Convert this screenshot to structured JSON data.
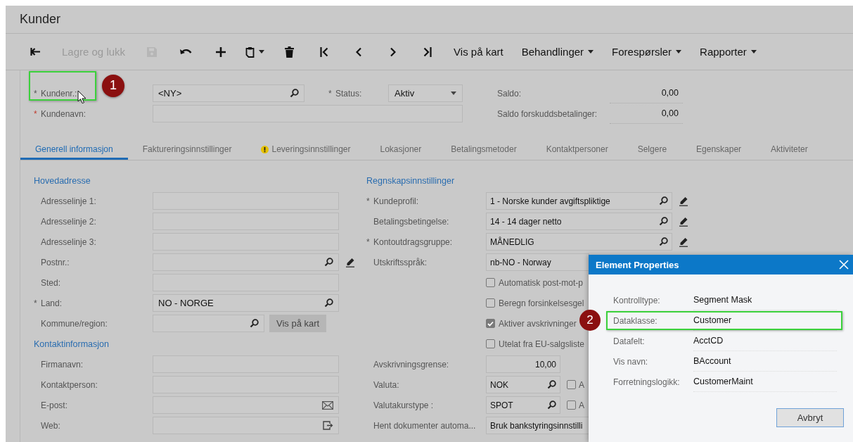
{
  "window": {
    "title": "Kunder"
  },
  "toolbar": [
    {
      "kind": "back",
      "disabled": false,
      "dropdown": false
    },
    {
      "kind": "text",
      "label": "Lagre og lukk",
      "disabled": true,
      "dropdown": false
    },
    {
      "kind": "save",
      "disabled": true,
      "dropdown": false
    },
    {
      "kind": "undo",
      "disabled": false,
      "dropdown": false
    },
    {
      "kind": "add",
      "disabled": false,
      "dropdown": false
    },
    {
      "kind": "paste",
      "disabled": false,
      "dropdown": true
    },
    {
      "kind": "delete",
      "disabled": false,
      "dropdown": false
    },
    {
      "kind": "first",
      "disabled": false,
      "dropdown": false
    },
    {
      "kind": "prev",
      "disabled": false,
      "dropdown": false
    },
    {
      "kind": "next",
      "disabled": false,
      "dropdown": false
    },
    {
      "kind": "last",
      "disabled": false,
      "dropdown": false
    },
    {
      "kind": "text",
      "label": "Vis på kart",
      "disabled": false,
      "dropdown": false
    },
    {
      "kind": "text",
      "label": "Behandlinger",
      "disabled": false,
      "dropdown": true
    },
    {
      "kind": "text",
      "label": "Forespørsler",
      "disabled": false,
      "dropdown": true
    },
    {
      "kind": "text",
      "label": "Rapporter",
      "disabled": false,
      "dropdown": true
    }
  ],
  "header": {
    "customer_id": {
      "mark": "*",
      "error": false,
      "label": "Kundenr.:",
      "value": "<NY>",
      "highlight": true,
      "callout": "1"
    },
    "status": {
      "mark": "*",
      "error": false,
      "label": "Status:",
      "value": "Aktiv"
    },
    "customer_name": {
      "mark": "*",
      "error": true,
      "label": "Kundenavn:"
    },
    "balances": [
      {
        "label": "Saldo:",
        "value": "0,00"
      },
      {
        "label": "Saldo forskuddsbetalinger:",
        "value": "0,00"
      }
    ]
  },
  "tabs": [
    {
      "label": "Generell informasjon",
      "selected": true,
      "warning": false
    },
    {
      "label": "Faktureringsinnstillinger",
      "selected": false,
      "warning": false
    },
    {
      "label": "Leveringsinnstillinger",
      "selected": false,
      "warning": true
    },
    {
      "label": "Lokasjoner",
      "selected": false,
      "warning": false
    },
    {
      "label": "Betalingsmetoder",
      "selected": false,
      "warning": false
    },
    {
      "label": "Kontaktpersoner",
      "selected": false,
      "warning": false
    },
    {
      "label": "Selgere",
      "selected": false,
      "warning": false
    },
    {
      "label": "Egenskaper",
      "selected": false,
      "warning": false
    },
    {
      "label": "Aktiviteter",
      "selected": false,
      "warning": false
    }
  ],
  "left_column": [
    {
      "kind": "heading",
      "text": "Hovedadresse"
    },
    {
      "kind": "field",
      "label": "Adresselinje 1:"
    },
    {
      "kind": "field",
      "label": "Adresselinje 2:"
    },
    {
      "kind": "field",
      "label": "Adresselinje 3:"
    },
    {
      "kind": "field",
      "label": "Postnr.:",
      "lookup": true,
      "edit": true
    },
    {
      "kind": "field",
      "label": "Sted:"
    },
    {
      "kind": "field",
      "mark": "*",
      "error": false,
      "label": "Land:",
      "value": "NO - NORGE",
      "lookup": true
    },
    {
      "kind": "field_button",
      "label": "Kommune/region:",
      "lookup": true,
      "button": "Vis på kart"
    },
    {
      "kind": "heading",
      "text": "Kontaktinformasjon"
    },
    {
      "kind": "field",
      "label": "Firmanavn:"
    },
    {
      "kind": "field",
      "label": "Kontaktperson:"
    },
    {
      "kind": "field",
      "label": "E-post:",
      "email": true
    },
    {
      "kind": "field",
      "label": "Web:",
      "link": true
    }
  ],
  "right_column": [
    {
      "kind": "heading",
      "text": "Regnskapsinnstillinger"
    },
    {
      "kind": "field",
      "mark": "*",
      "error": false,
      "label": "Kundeprofil:",
      "value": "1 - Norske kunder avgiftspliktige",
      "lookup": true,
      "edit": true
    },
    {
      "kind": "field",
      "label": "Betalingsbetingelse:",
      "value": "14 - 14 dager netto",
      "lookup": true,
      "edit": true
    },
    {
      "kind": "field",
      "mark": "*",
      "error": false,
      "label": "Kontoutdragsgruppe:",
      "value": "MÅNEDLIG",
      "lookup": true,
      "edit": true
    },
    {
      "kind": "field",
      "label": "Utskriftsspråk:",
      "value": "nb-NO - Norway"
    },
    {
      "kind": "checkbox",
      "label": "Automatisk post-mot-p",
      "checked": false
    },
    {
      "kind": "checkbox",
      "label": "Beregn forsinkelsesgel",
      "checked": false
    },
    {
      "kind": "checkbox",
      "label": "Aktiver avskrivninger",
      "checked": true
    },
    {
      "kind": "checkbox",
      "label": "Utelat fra EU-salgsliste",
      "checked": false
    },
    {
      "kind": "number",
      "label": "Avskrivningsgrense:",
      "value": "10,00"
    },
    {
      "kind": "short",
      "label": "Valuta:",
      "value": "NOK",
      "lookup": true,
      "side_checkbox": {
        "label": "A",
        "checked": false
      }
    },
    {
      "kind": "short",
      "label": "Valutakurstype :",
      "value": "SPOT",
      "lookup": true,
      "side_checkbox": {
        "label": "A",
        "checked": false
      }
    },
    {
      "kind": "field",
      "label": "Hent dokumenter automa...",
      "value": "Bruk bankstyringsinnstilli"
    }
  ],
  "dialog": {
    "title": "Element Properties",
    "rows": [
      {
        "label": "Kontrolltype:",
        "value": "Segment Mask",
        "highlight": false
      },
      {
        "label": "Dataklasse:",
        "value": "Customer",
        "highlight": true,
        "callout": "2"
      },
      {
        "label": "Datafelt:",
        "value": "AcctCD",
        "highlight": false
      },
      {
        "label": "Vis navn:",
        "value": "BAccount",
        "highlight": false
      },
      {
        "label": "Forretningslogikk:",
        "value": "CustomerMaint",
        "highlight": false
      }
    ],
    "button": "Avbryt"
  }
}
